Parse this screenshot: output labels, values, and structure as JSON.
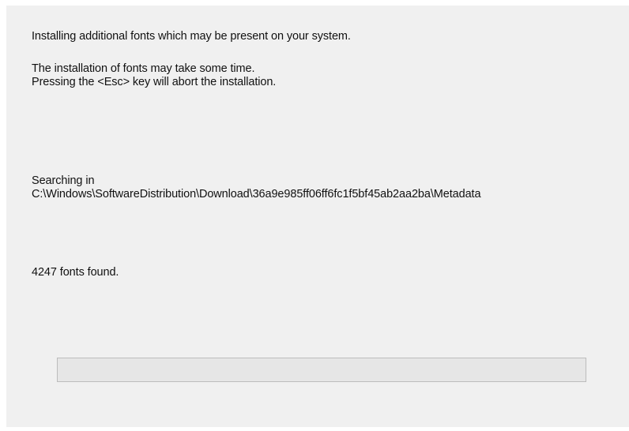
{
  "dialog": {
    "intro_line": "Installing additional  fonts which may be present on your system.",
    "time_line": "The installation of fonts may take some time.",
    "abort_line": "Pressing the <Esc> key will abort the installation.",
    "searching_label": "Searching in",
    "search_path": "C:\\Windows\\SoftwareDistribution\\Download\\36a9e985ff06ff6fc1f5bf45ab2aa2ba\\Metadata",
    "fonts_found": "4247 fonts found.",
    "progress_fraction": 0.0
  }
}
